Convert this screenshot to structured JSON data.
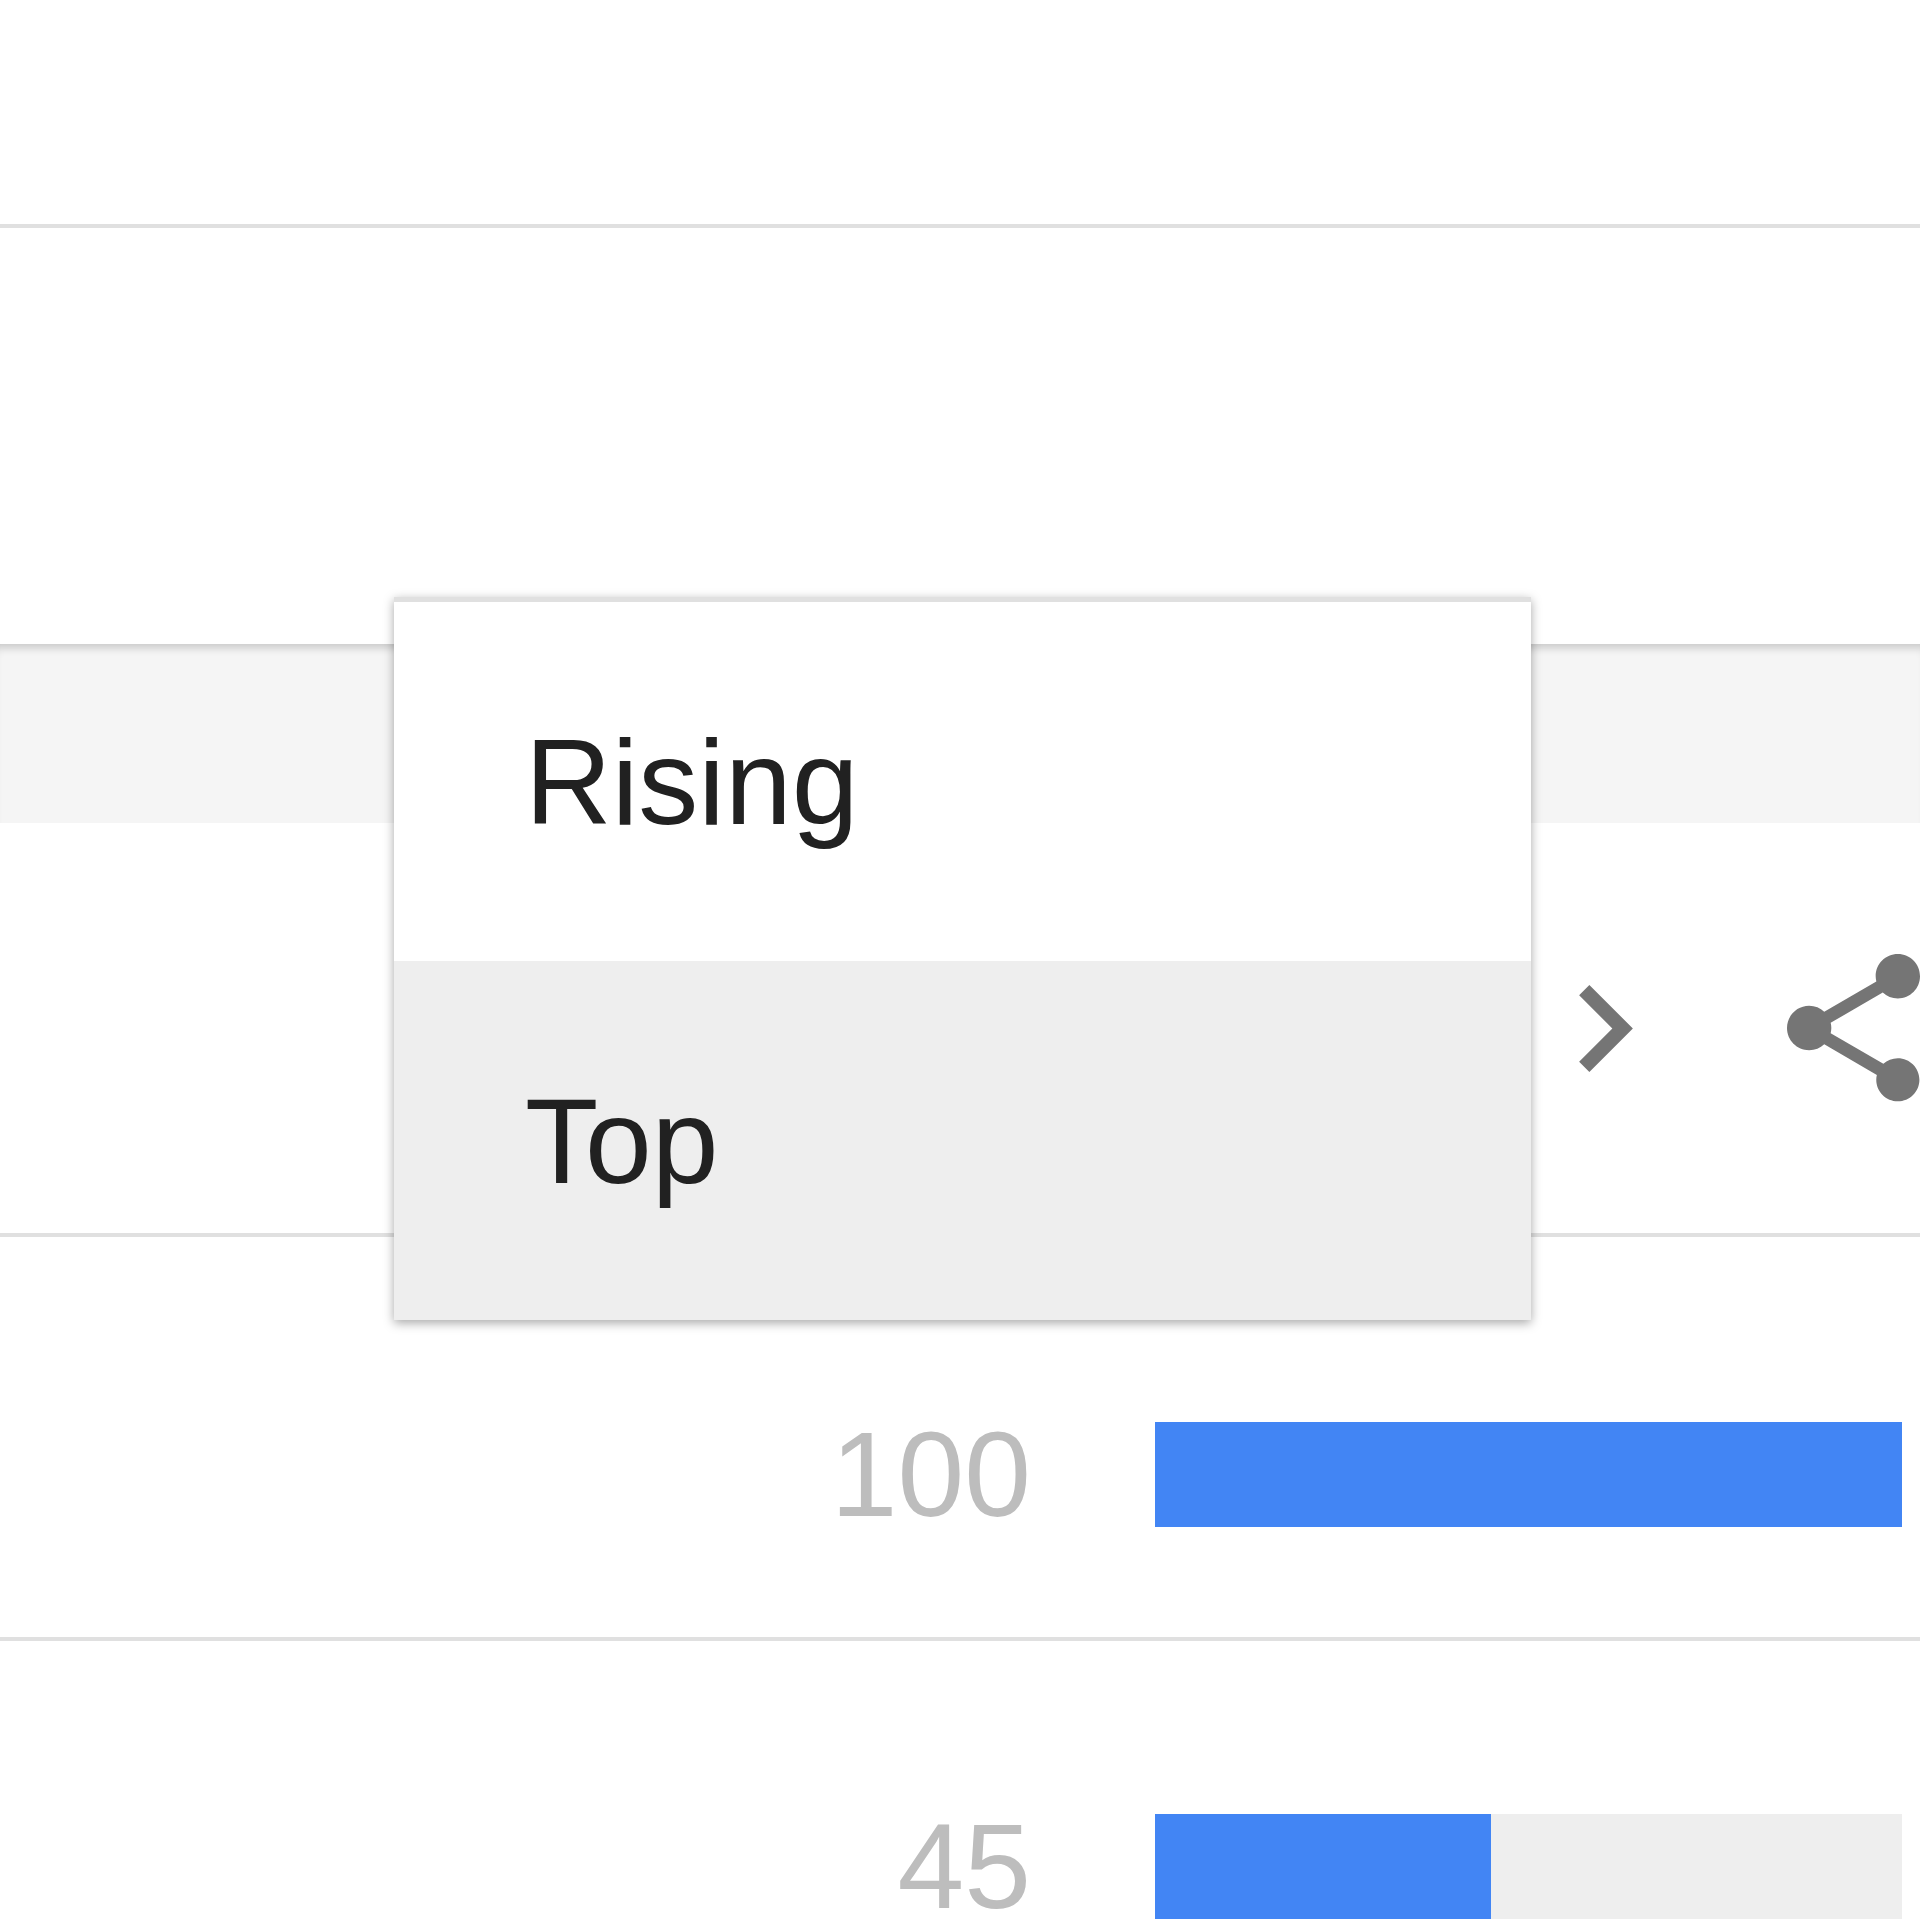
{
  "menu": {
    "items": [
      {
        "label": "Rising",
        "selected": false
      },
      {
        "label": "Top",
        "selected": true
      }
    ]
  },
  "rows": [
    {
      "value": "100",
      "level": 1
    },
    {
      "value": "45",
      "level": 0.45
    }
  ]
}
